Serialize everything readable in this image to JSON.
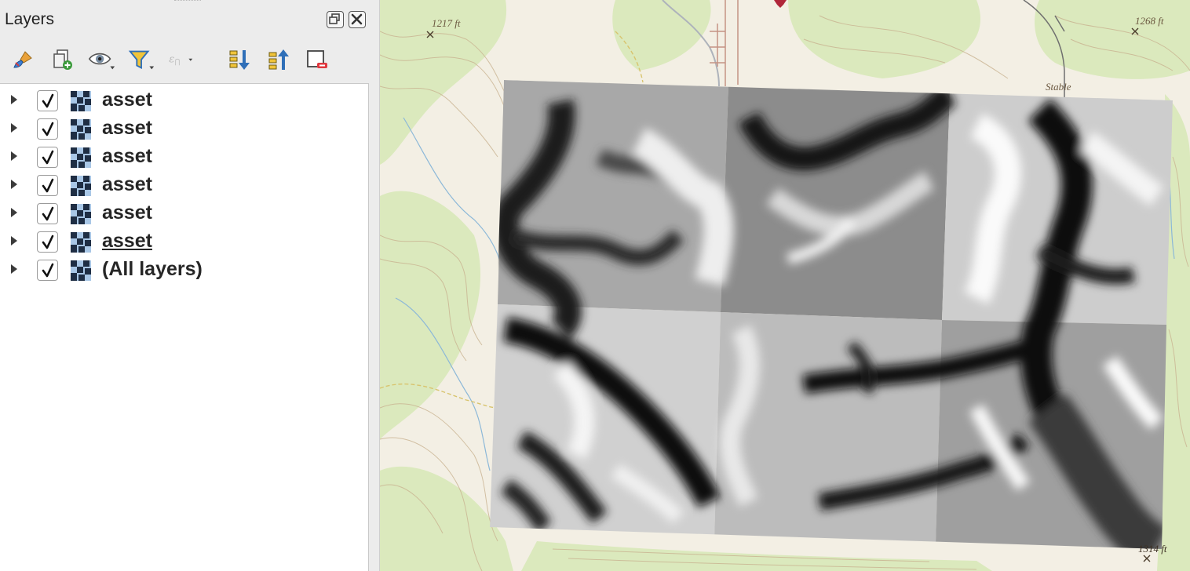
{
  "panel": {
    "title": "Layers",
    "title_buttons": [
      {
        "name": "float-panel-button",
        "icon": "float-icon"
      },
      {
        "name": "close-panel-button",
        "icon": "close-icon"
      }
    ],
    "toolbar": [
      {
        "name": "style-manager-button",
        "icon": "paint-brush-icon"
      },
      {
        "name": "add-group-button",
        "icon": "add-group-icon"
      },
      {
        "name": "manage-visibility-button",
        "icon": "eye-icon"
      },
      {
        "name": "filter-legend-button",
        "icon": "filter-icon"
      },
      {
        "name": "filter-by-expression-button",
        "icon": "expression-icon"
      },
      {
        "name": "expand-all-button",
        "icon": "expand-all-icon"
      },
      {
        "name": "collapse-all-button",
        "icon": "collapse-all-icon"
      },
      {
        "name": "remove-layer-button",
        "icon": "remove-layer-icon"
      }
    ]
  },
  "layers": [
    {
      "label": "asset",
      "checked": true,
      "current": false
    },
    {
      "label": "asset",
      "checked": true,
      "current": false
    },
    {
      "label": "asset",
      "checked": true,
      "current": false
    },
    {
      "label": "asset",
      "checked": true,
      "current": false
    },
    {
      "label": "asset",
      "checked": true,
      "current": false
    },
    {
      "label": "asset",
      "checked": true,
      "current": true
    },
    {
      "label": "(All layers)",
      "checked": true,
      "current": false
    }
  ],
  "map": {
    "labels": {
      "peak_1217": "1217 ft",
      "peak_1268": "1268 ft",
      "stable": "Stable",
      "peak_1314": "1314 ft"
    },
    "colors": {
      "basemap": "#f3efe4",
      "vegetation": "#dbe9bd",
      "contour": "#c9b391",
      "stream": "#8cb8d8",
      "road": "#aeb3bb",
      "runway": "#c59383",
      "trail": "#d8c46e",
      "airport_marker": "#b0263a"
    }
  }
}
